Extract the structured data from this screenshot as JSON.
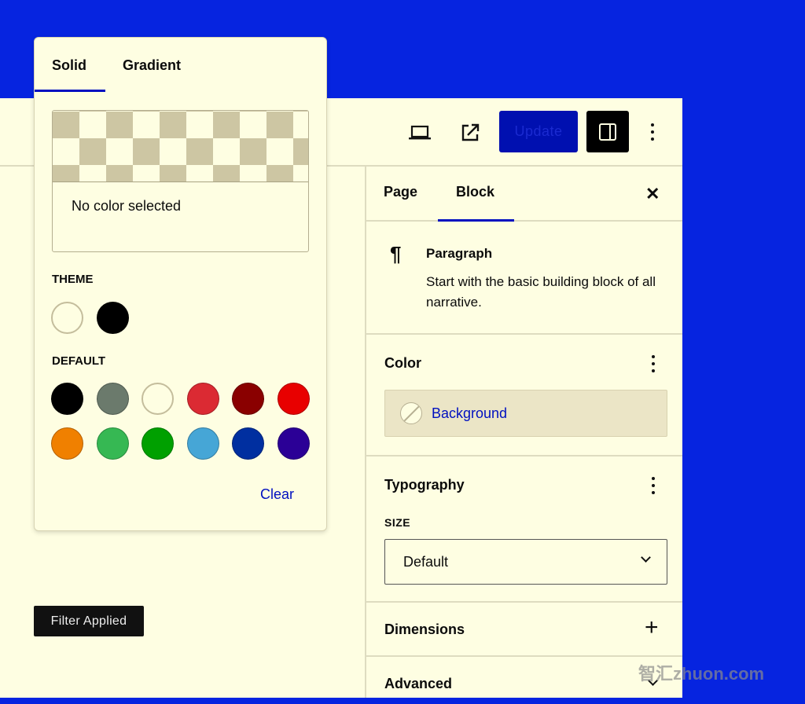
{
  "toolbar": {
    "update_label": "Update",
    "icons": [
      "laptop-icon",
      "external-link-icon",
      "sidebar-toggle-icon",
      "more-vertical-icon"
    ]
  },
  "sidebar": {
    "tabs": [
      {
        "label": "Page"
      },
      {
        "label": "Block",
        "active": true
      }
    ],
    "close_icon": "✕",
    "block": {
      "icon": "¶",
      "title": "Paragraph",
      "description": "Start with the basic building block of all narrative."
    },
    "color": {
      "title": "Color",
      "background_label": "Background"
    },
    "typography": {
      "title": "Typography",
      "size_label": "SIZE",
      "size_value": "Default"
    },
    "dimensions": {
      "title": "Dimensions",
      "icon": "+"
    },
    "advanced": {
      "title": "Advanced"
    }
  },
  "popover": {
    "tabs": [
      {
        "label": "Solid",
        "active": true
      },
      {
        "label": "Gradient"
      }
    ],
    "preview_text": "No color selected",
    "theme_label": "THEME",
    "theme_colors": [
      "#fefee2",
      "#000000"
    ],
    "default_label": "DEFAULT",
    "default_colors": [
      "#000000",
      "#6b7a6c",
      "#fefee2",
      "#db2a33",
      "#8a0000",
      "#e80000",
      "#f08000",
      "#36b853",
      "#00a000",
      "#46a6d6",
      "#002fa0",
      "#2b0096"
    ],
    "clear_label": "Clear"
  },
  "filter_badge": "Filter Applied",
  "watermark": "智汇zhuon.com",
  "colors": {
    "background": "#0624e0",
    "surface": "#fefee2",
    "accent": "#0010c0"
  }
}
